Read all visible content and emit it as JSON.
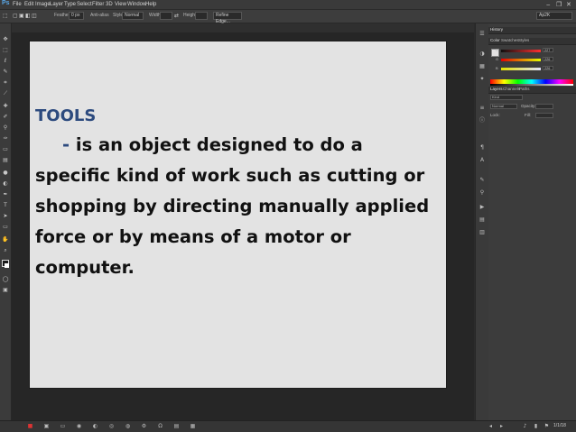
{
  "app": {
    "logo": "Ps",
    "menu": [
      "File",
      "Edit",
      "Image",
      "Layer",
      "Type",
      "Select",
      "Filter",
      "3D",
      "View",
      "Window",
      "Help"
    ],
    "window_controls": {
      "minimize": "‒",
      "restore": "❐",
      "close": "✕"
    }
  },
  "options_bar": {
    "feather_label": "Feather:",
    "feather_value": "0 px",
    "antialias_label": "Anti-alias",
    "style_label": "Style:",
    "style_value": "Normal",
    "width_label": "Width:",
    "height_label": "Height:",
    "refine_edge_label": "Refine Edge...",
    "workspace_value": "Ap2K"
  },
  "document": {
    "title": "TOOLS",
    "dash": "- ",
    "body_first": "is an object designed to do a",
    "body_rest": "specific kind of work such as cutting or shopping by directing manually applied force or by means of a motor or computer."
  },
  "panels": {
    "history_tab": "History",
    "color_tabs": [
      "Color",
      "Swatches",
      "Styles"
    ],
    "color_values": {
      "r": "227",
      "g": "226",
      "b": "226"
    },
    "layers_tabs": [
      "Layers",
      "Channels",
      "Paths"
    ],
    "layers_kind": "Kind",
    "layers_blend": "Normal",
    "layers_opacity_label": "Opacity:",
    "layers_lock_label": "Lock:",
    "layers_fill_label": "Fill:"
  },
  "status": {
    "page": "1/1/18"
  },
  "colors": {
    "accent": "#2c4a7e",
    "canvas_bg": "#e3e3e3",
    "app_bg": "#2b2b2b"
  }
}
